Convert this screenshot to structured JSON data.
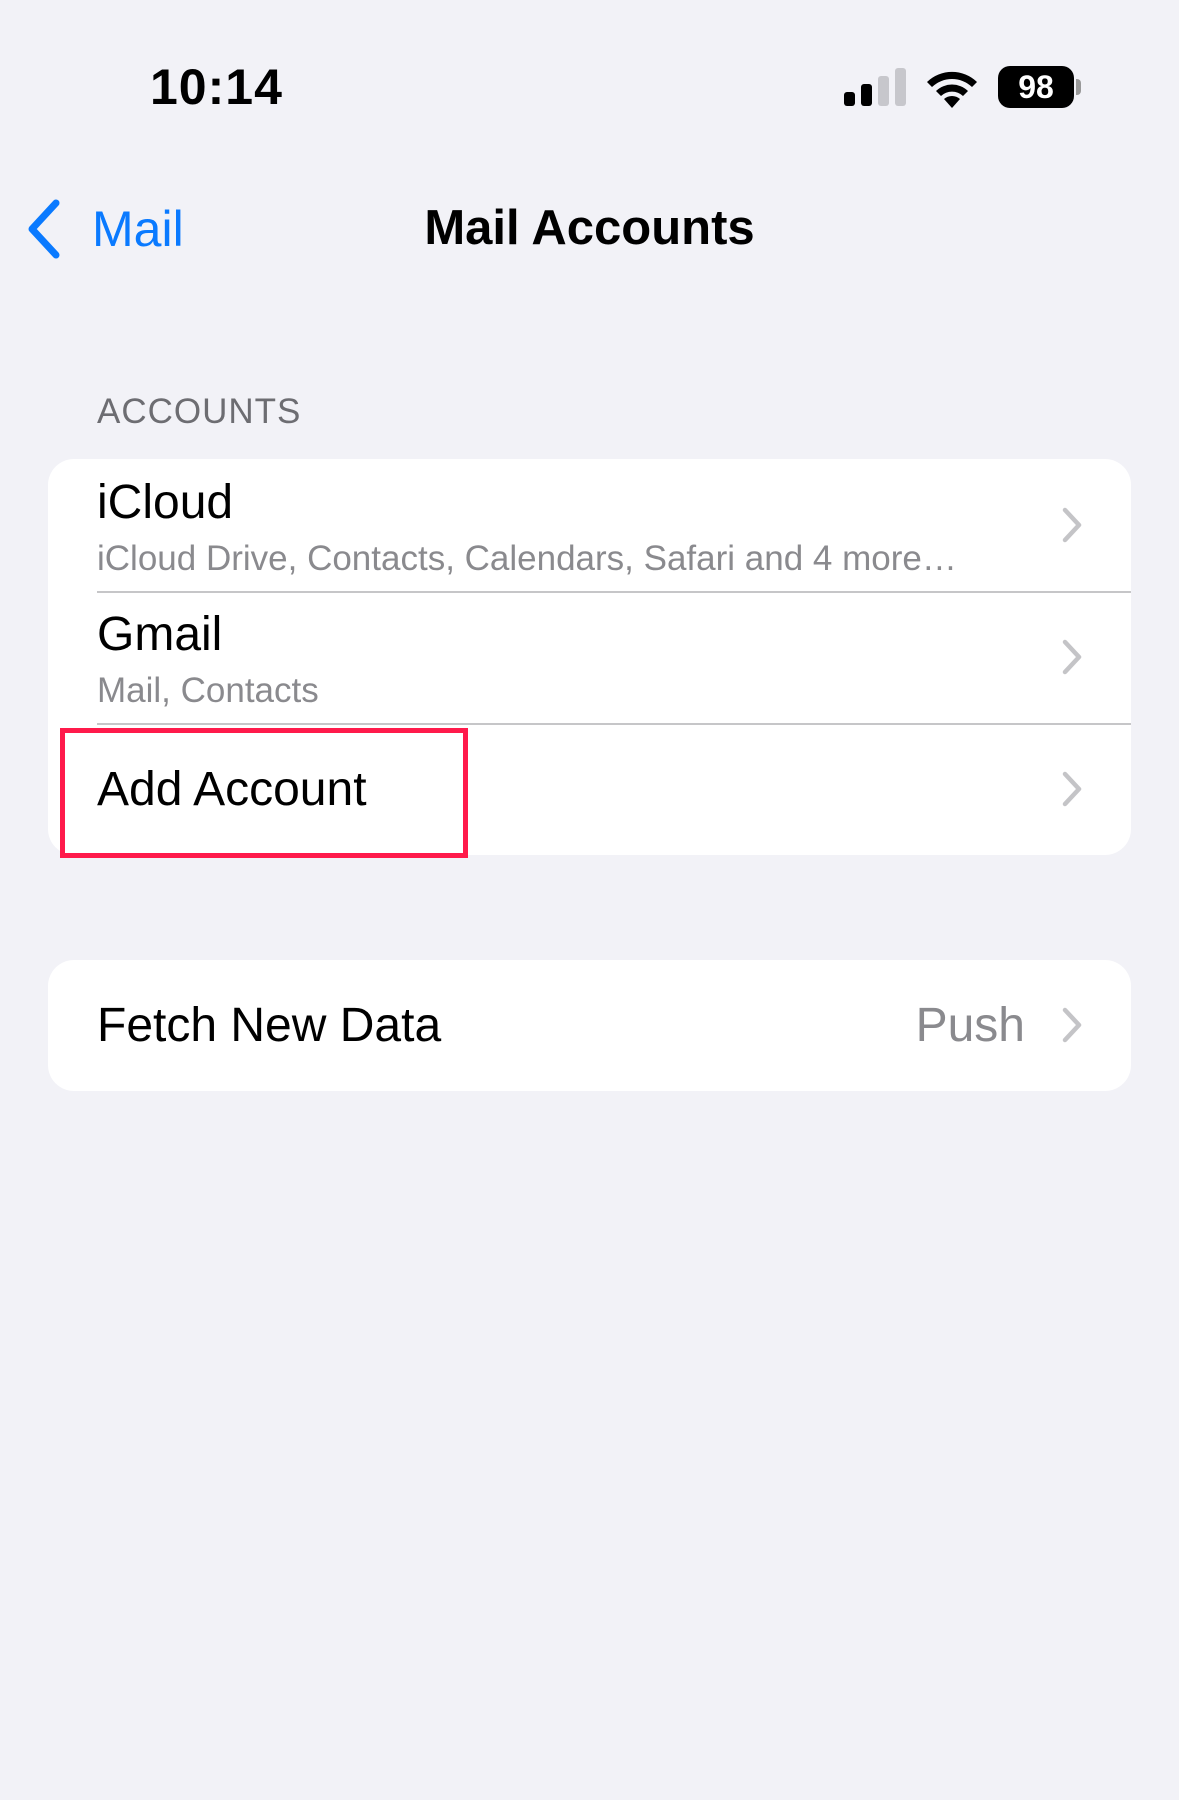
{
  "status_bar": {
    "time": "10:14",
    "battery_level": "98",
    "icons": [
      "signal-icon",
      "wifi-icon",
      "battery-icon"
    ]
  },
  "nav": {
    "back_label": "Mail",
    "title": "Mail Accounts"
  },
  "accounts_section": {
    "header": "ACCOUNTS",
    "rows": [
      {
        "title": "iCloud",
        "subtitle": "iCloud Drive, Contacts, Calendars, Safari and 4 more…"
      },
      {
        "title": "Gmail",
        "subtitle": "Mail, Contacts"
      },
      {
        "title": "Add Account"
      }
    ]
  },
  "fetch_section": {
    "title": "Fetch New Data",
    "value": "Push"
  },
  "colors": {
    "background": "#f2f2f7",
    "accent": "#0a7aff",
    "highlight": "#ff1a4b",
    "secondary_text": "#8a8a8e"
  }
}
